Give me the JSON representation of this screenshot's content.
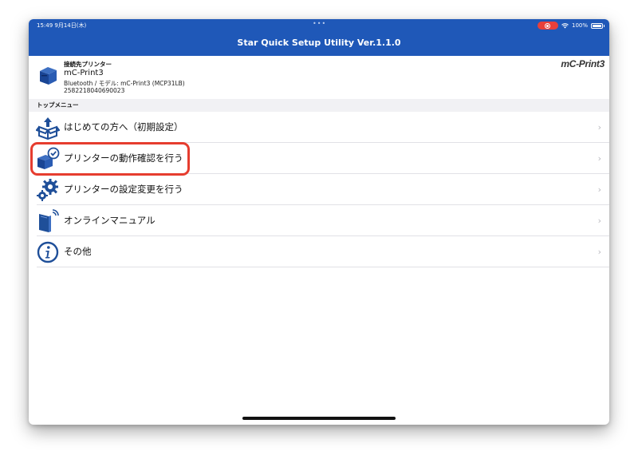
{
  "status_bar": {
    "time": "15:49  9月14日(木)",
    "battery": "100%"
  },
  "navbar": {
    "title": "Star Quick Setup Utility Ver.1.1.0"
  },
  "printer": {
    "label": "接続先プリンター",
    "name": "mC-Print3",
    "model": "Bluetooth / モデル: mC-Print3 (MCP31LB)",
    "serial": "2582218040690023",
    "logo": "mC-Print3"
  },
  "section": {
    "title": "トップメニュー"
  },
  "menu": {
    "items": [
      {
        "label": "はじめての方へ（初期設定）",
        "icon": "box-arrow-up-icon"
      },
      {
        "label": "プリンターの動作確認を行う",
        "icon": "printer-check-icon"
      },
      {
        "label": "プリンターの設定変更を行う",
        "icon": "gears-icon"
      },
      {
        "label": "オンラインマニュアル",
        "icon": "book-wireless-icon"
      },
      {
        "label": "その他",
        "icon": "info-icon"
      }
    ],
    "chevron": "›"
  },
  "colors": {
    "primary": "#1f58b8",
    "highlight": "#e63d2f",
    "icon_blue": "#1f4f99"
  }
}
